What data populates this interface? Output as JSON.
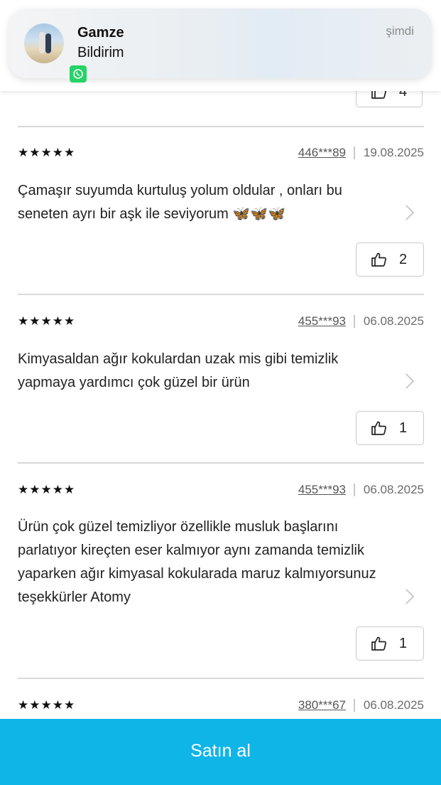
{
  "notification": {
    "sender": "Gamze",
    "body": "Bildirim",
    "time": "şimdi",
    "app_icon": "whatsapp-icon",
    "app_color": "#25d366"
  },
  "partial_review": {
    "like_count": "4"
  },
  "reviews": [
    {
      "stars": "★★★★★",
      "user": "446***89",
      "date": "19.08.2025",
      "text": "Çamaşır suyumda kurtuluş yolum oldular , onları bu seneten ayrı bir aşk ile seviyorum 🦋🦋🦋",
      "like_count": "2"
    },
    {
      "stars": "★★★★★",
      "user": "455***93",
      "date": "06.08.2025",
      "text": "Kimyasaldan ağır kokulardan uzak mis gibi temizlik yapmaya yardımcı çok güzel bir ürün",
      "like_count": "1"
    },
    {
      "stars": "★★★★★",
      "user": "455***93",
      "date": "06.08.2025",
      "text": "Ürün çok güzel temizliyor özellikle musluk başlarını parlatıyor kireçten eser kalmıyor aynı zamanda temizlik yaparken ağır kimyasal kokularada maruz kalmıyorsunuz teşekkürler Atomy",
      "like_count": "1"
    },
    {
      "stars": "★★★★★",
      "user": "380***67",
      "date": "06.08.2025"
    }
  ],
  "buy_button": {
    "label": "Satın al",
    "color": "#10b5e8"
  }
}
